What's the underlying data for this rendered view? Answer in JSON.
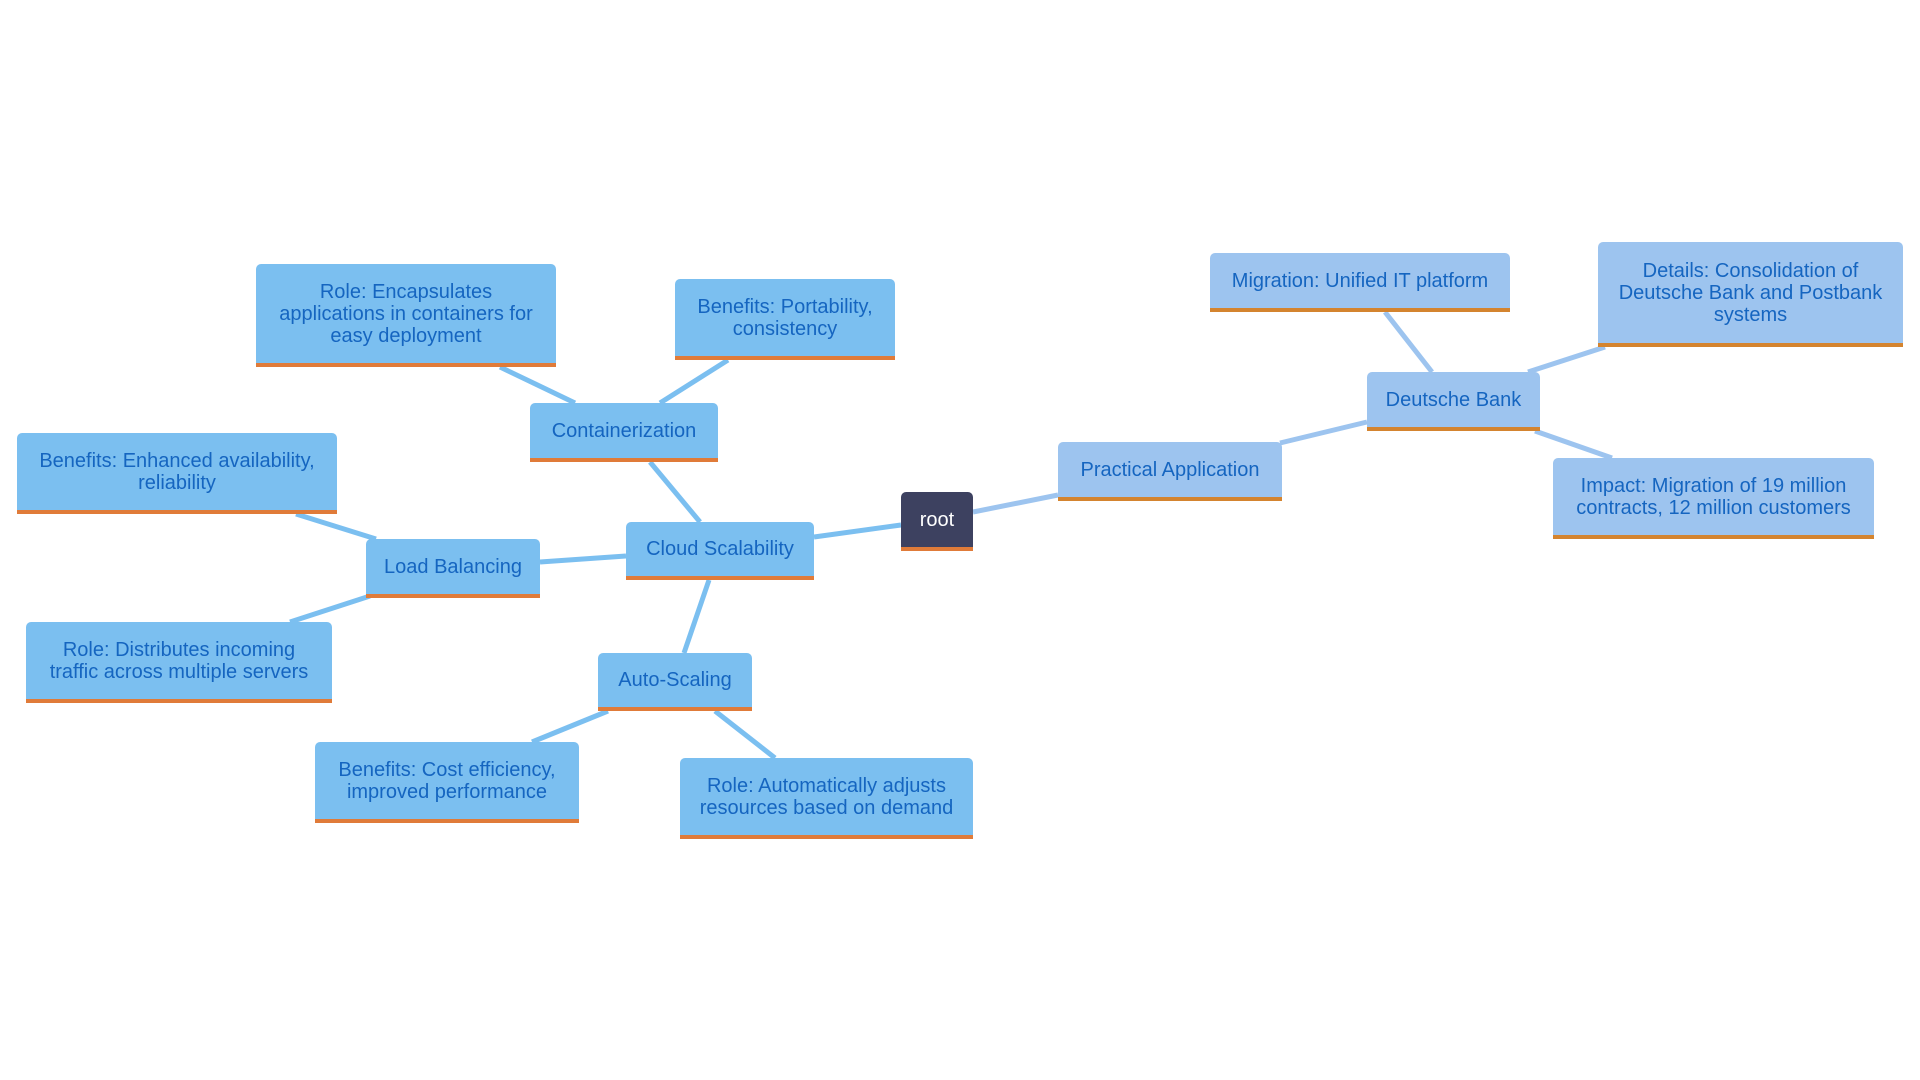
{
  "diagram": {
    "type": "mindmap",
    "root": {
      "id": "root",
      "label": "root"
    },
    "nodes": [
      {
        "id": "cloud",
        "label": "Cloud Scalability",
        "parent": "root"
      },
      {
        "id": "contain",
        "label": "Containerization",
        "parent": "cloud"
      },
      {
        "id": "contain_role",
        "label": "Role: Encapsulates applications in containers for easy deployment",
        "parent": "contain"
      },
      {
        "id": "contain_ben",
        "label": "Benefits: Portability, consistency",
        "parent": "contain"
      },
      {
        "id": "lb",
        "label": "Load Balancing",
        "parent": "cloud"
      },
      {
        "id": "lb_ben",
        "label": "Benefits: Enhanced availability, reliability",
        "parent": "lb"
      },
      {
        "id": "lb_role",
        "label": "Role: Distributes incoming traffic across multiple servers",
        "parent": "lb"
      },
      {
        "id": "as",
        "label": "Auto-Scaling",
        "parent": "cloud"
      },
      {
        "id": "as_ben",
        "label": "Benefits: Cost efficiency, improved performance",
        "parent": "as"
      },
      {
        "id": "as_role",
        "label": "Role: Automatically adjusts resources based on demand",
        "parent": "as"
      },
      {
        "id": "prac",
        "label": "Practical Application",
        "parent": "root"
      },
      {
        "id": "db",
        "label": "Deutsche Bank",
        "parent": "prac"
      },
      {
        "id": "db_mig",
        "label": "Migration: Unified IT platform",
        "parent": "db"
      },
      {
        "id": "db_det",
        "label": "Details: Consolidation of Deutsche Bank and Postbank systems",
        "parent": "db"
      },
      {
        "id": "db_imp",
        "label": "Impact: Migration of 19 million contracts, 12 million customers",
        "parent": "db"
      }
    ],
    "colors": {
      "node_fill": "#7bbff0",
      "branch_fill": "#9dc4ef",
      "root_fill": "#3d4160",
      "accent_border": "#e07b39",
      "text": "#1565c0",
      "edge_left": "#7bbff0",
      "edge_right": "#9dc4ef"
    }
  }
}
